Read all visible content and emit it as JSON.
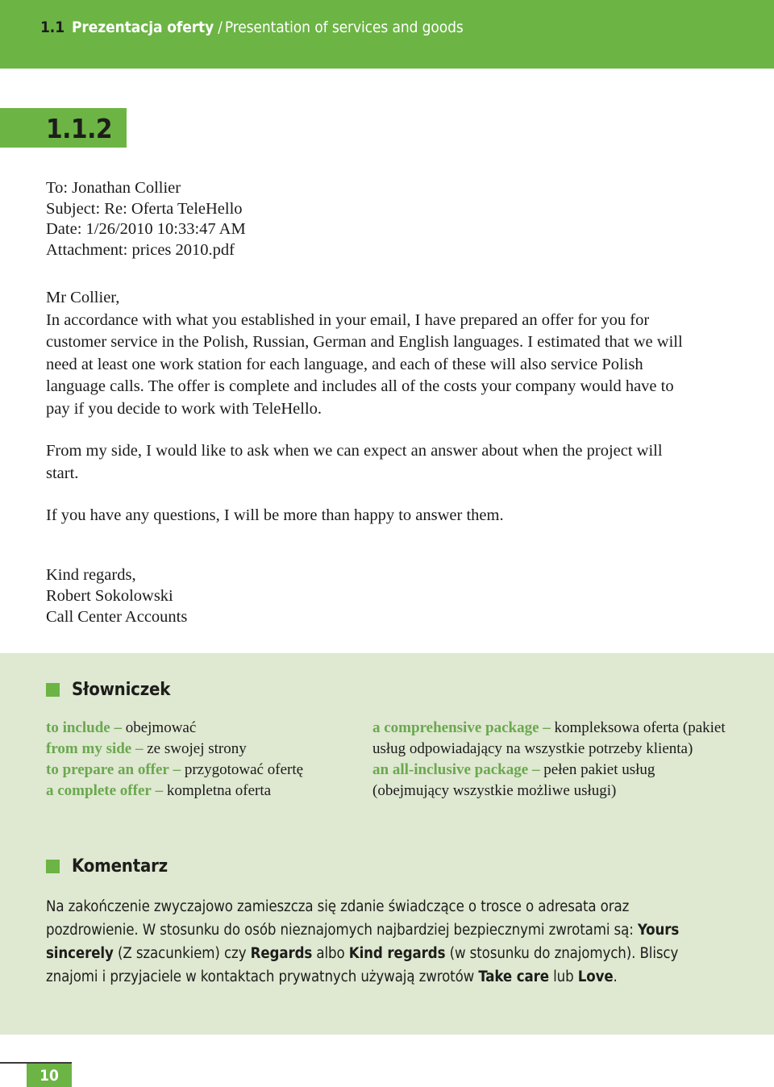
{
  "running_head": {
    "number": "1.1",
    "title_pl": "Prezentacja oferty",
    "separator": "/",
    "title_en": "Presentation of services and goods"
  },
  "section": {
    "tab_number": "1.1.2"
  },
  "email": {
    "headers": [
      "To: Jonathan Collier",
      "Subject: Re: Oferta TeleHello",
      "Date: 1/26/2010 10:33:47 AM",
      "Attachment: prices 2010.pdf"
    ],
    "paragraphs": [
      "Mr Collier,",
      "In accordance with what you established in your email, I have prepared an offer for you for customer service in the Polish, Russian, German and English languages. I estimated that we will need at least one work station for each language, and each of these will also service Polish language calls. The offer is complete and includes all of the costs your company would have to pay if you decide to work with TeleHello.",
      "From my side, I would like to ask when we can expect an answer about when the project will start.",
      "If you have any questions, I will be more than happy to answer them."
    ],
    "signature": [
      "Kind regards,",
      "Robert Sokolowski",
      "Call Center Accounts"
    ]
  },
  "glossary": {
    "heading": "Słowniczek",
    "left_column": [
      {
        "term": "to include",
        "dash": "–",
        "definition": "obejmować"
      },
      {
        "term": "from my side",
        "dash": "–",
        "definition": "ze swojej strony"
      },
      {
        "term": "to prepare an offer",
        "dash": "–",
        "definition": "przygotować ofertę"
      },
      {
        "term": "a complete offer",
        "dash": "–",
        "definition": "kompletna oferta"
      }
    ],
    "right_column": [
      {
        "term": "a comprehensive package",
        "dash": "–",
        "definition": "kompleksowa oferta (pakiet usług odpowiadający na wszystkie potrzeby klienta)"
      },
      {
        "term": "an all-inclusive package",
        "dash": "–",
        "definition": "pełen pakiet usług (obejmujący wszystkie możliwe usługi)"
      }
    ]
  },
  "commentary": {
    "heading": "Komentarz",
    "segments": [
      {
        "text": "Na zakończenie zwyczajowo zamieszcza się zdanie świadczące o trosce o adresata oraz pozdrowienie. W stosunku do osób nieznajomych najbardziej bezpiecznymi zwrotami są: ",
        "bold": false
      },
      {
        "text": "Yours sincerely",
        "bold": true
      },
      {
        "text": " (Z szacunkiem) czy ",
        "bold": false
      },
      {
        "text": "Regards",
        "bold": true
      },
      {
        "text": " albo ",
        "bold": false
      },
      {
        "text": "Kind regards",
        "bold": true
      },
      {
        "text": " (w stosunku do znajomych). Bliscy znajomi i przyjaciele w kontaktach prywatnych używają zwrotów ",
        "bold": false
      },
      {
        "text": "Take care",
        "bold": true
      },
      {
        "text": " lub ",
        "bold": false
      },
      {
        "text": "Love",
        "bold": true
      },
      {
        "text": ".",
        "bold": false
      }
    ]
  },
  "footer": {
    "page_number": "10"
  },
  "colors": {
    "accent_green": "#6cb444",
    "panel_green": "#dfe8d1",
    "term_green": "#6aa84f",
    "text_black": "#1b1b1b"
  }
}
